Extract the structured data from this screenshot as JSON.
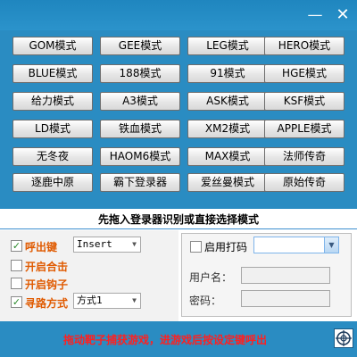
{
  "window": {
    "minimize_glyph": "—",
    "close_glyph": "✕"
  },
  "modes": [
    "GOM模式",
    "GEE模式",
    "LEG模式",
    "HERO模式",
    "BLUE模式",
    "188模式",
    "91模式",
    "HGE模式",
    "给力模式",
    "A3模式",
    "ASK模式",
    "KSF模式",
    "LD模式",
    "铁血模式",
    "XM2模式",
    "APPLE模式",
    "无冬夜",
    "HAOM6模式",
    "MAX模式",
    "法师传奇",
    "逐鹿中原",
    "霸下登录器",
    "爱丝曼模式",
    "原始传奇"
  ],
  "hint": "先拖入登录器识别或直接选择模式",
  "options": {
    "hotkey": {
      "label": "呼出键",
      "checked": true,
      "check_glyph": "✓",
      "value": "Insert"
    },
    "auto_attack": {
      "label": "开启合击",
      "checked": false
    },
    "hook": {
      "label": "开启钩子",
      "checked": false
    },
    "pathfinding": {
      "label": "寻路方式",
      "checked": true,
      "check_glyph": "✓",
      "value": "方式1"
    }
  },
  "login": {
    "enable_label": "启用打码",
    "enable_checked": false,
    "username_label": "用户名：",
    "password_label": "密码："
  },
  "footer": {
    "text": "拖动靶子捕获游戏，进游戏后按设定键呼出",
    "crosshair_icon": "crosshair-icon"
  },
  "colors": {
    "background": "#2a8cc2",
    "accent_orange": "#e05a00",
    "footer_red": "#ff2020"
  }
}
